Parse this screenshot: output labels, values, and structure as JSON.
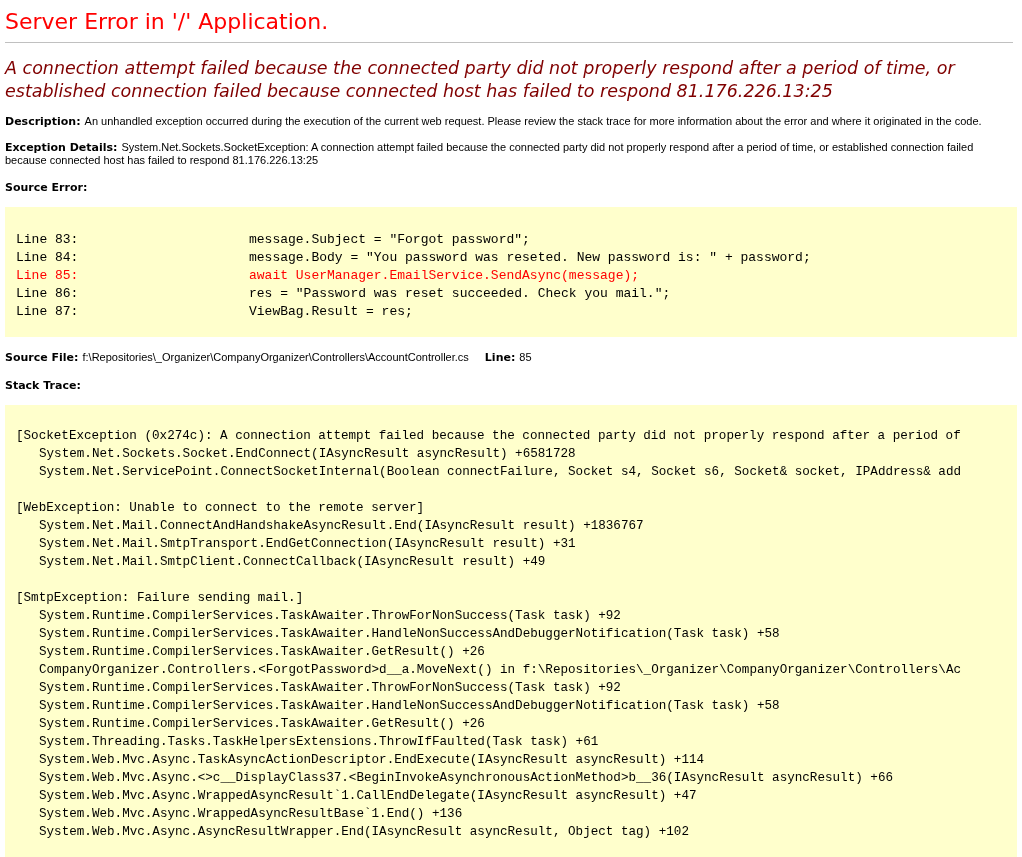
{
  "title": "Server Error in '/' Application.",
  "message": "A connection attempt failed because the connected party did not properly respond after a period of time, or established connection failed because connected host has failed to respond 81.176.226.13:25",
  "description": {
    "label": "Description:",
    "text": "An unhandled exception occurred during the execution of the current web request. Please review the stack trace for more information about the error and where it originated in the code."
  },
  "exception_details": {
    "label": "Exception Details:",
    "text": "System.Net.Sockets.SocketException: A connection attempt failed because the connected party did not properly respond after a period of time, or established connection failed because connected host has failed to respond 81.176.226.13:25"
  },
  "source_error": {
    "label": "Source Error:",
    "lines": [
      {
        "number": "Line 83:",
        "code": "message.Subject = \"Forgot password\";",
        "highlighted": false
      },
      {
        "number": "Line 84:",
        "code": "message.Body = \"You password was reseted. New password is: \" + password;",
        "highlighted": false
      },
      {
        "number": "Line 85:",
        "code": "await UserManager.EmailService.SendAsync(message);",
        "highlighted": true
      },
      {
        "number": "Line 86:",
        "code": "res = \"Password was reset succeeded. Check you mail.\";",
        "highlighted": false
      },
      {
        "number": "Line 87:",
        "code": "ViewBag.Result = res;",
        "highlighted": false
      }
    ]
  },
  "source_file": {
    "label": "Source File:",
    "path": "f:\\Repositories\\_Organizer\\CompanyOrganizer\\Controllers\\AccountController.cs",
    "line_label": "Line:",
    "line": "85"
  },
  "stack_trace": {
    "label": "Stack Trace:",
    "blocks": [
      {
        "header": "[SocketException (0x274c): A connection attempt failed because the connected party did not properly respond after a period of",
        "frames": [
          "System.Net.Sockets.Socket.EndConnect(IAsyncResult asyncResult) +6581728",
          "System.Net.ServicePoint.ConnectSocketInternal(Boolean connectFailure, Socket s4, Socket s6, Socket& socket, IPAddress& add"
        ]
      },
      {
        "header": "[WebException: Unable to connect to the remote server]",
        "frames": [
          "System.Net.Mail.ConnectAndHandshakeAsyncResult.End(IAsyncResult result) +1836767",
          "System.Net.Mail.SmtpTransport.EndGetConnection(IAsyncResult result) +31",
          "System.Net.Mail.SmtpClient.ConnectCallback(IAsyncResult result) +49"
        ]
      },
      {
        "header": "[SmtpException: Failure sending mail.]",
        "frames": [
          "System.Runtime.CompilerServices.TaskAwaiter.ThrowForNonSuccess(Task task) +92",
          "System.Runtime.CompilerServices.TaskAwaiter.HandleNonSuccessAndDebuggerNotification(Task task) +58",
          "System.Runtime.CompilerServices.TaskAwaiter.GetResult() +26",
          "CompanyOrganizer.Controllers.<ForgotPassword>d__a.MoveNext() in f:\\Repositories\\_Organizer\\CompanyOrganizer\\Controllers\\Ac",
          "System.Runtime.CompilerServices.TaskAwaiter.ThrowForNonSuccess(Task task) +92",
          "System.Runtime.CompilerServices.TaskAwaiter.HandleNonSuccessAndDebuggerNotification(Task task) +58",
          "System.Runtime.CompilerServices.TaskAwaiter.GetResult() +26",
          "System.Threading.Tasks.TaskHelpersExtensions.ThrowIfFaulted(Task task) +61",
          "System.Web.Mvc.Async.TaskAsyncActionDescriptor.EndExecute(IAsyncResult asyncResult) +114",
          "System.Web.Mvc.Async.<>c__DisplayClass37.<BeginInvokeAsynchronousActionMethod>b__36(IAsyncResult asyncResult) +66",
          "System.Web.Mvc.Async.WrappedAsyncResult`1.CallEndDelegate(IAsyncResult asyncResult) +47",
          "System.Web.Mvc.Async.WrappedAsyncResultBase`1.End() +136",
          "System.Web.Mvc.Async.AsyncResultWrapper.End(IAsyncResult asyncResult, Object tag) +102"
        ]
      }
    ]
  }
}
